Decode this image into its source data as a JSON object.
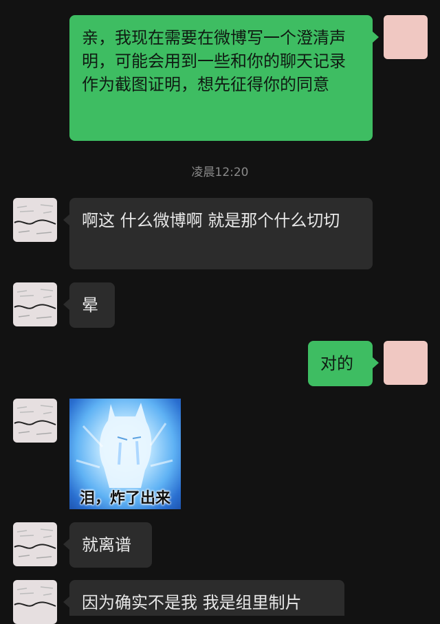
{
  "messages": [
    {
      "sender": "self",
      "text": "亲，我现在需要在微博写一个澄清声明，可能会用到一些和你的聊天记录作为截图证明，想先征得你的同意"
    },
    {
      "sender": "other",
      "text": "啊这 什么微博啊 就是那个什么切切"
    },
    {
      "sender": "other",
      "text": "晕"
    },
    {
      "sender": "self",
      "text": "对的"
    },
    {
      "sender": "other",
      "type": "sticker",
      "caption": "泪，炸了出来"
    },
    {
      "sender": "other",
      "text": "就离谱"
    },
    {
      "sender": "other",
      "text": "因为确实不是我 我是组里制片"
    }
  ],
  "timestamp": "凌晨12:20",
  "colors": {
    "background": "#121212",
    "self_bubble": "#3ebd62",
    "other_bubble": "#2c2c2c"
  }
}
